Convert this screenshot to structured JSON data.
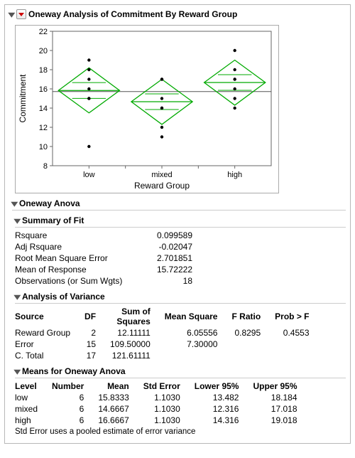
{
  "header": {
    "title": "Oneway Analysis of Commitment By Reward Group"
  },
  "chart_data": {
    "type": "scatter",
    "ylabel": "Commitment",
    "xlabel": "Reward Group",
    "ylim": [
      8,
      22
    ],
    "yticks": [
      8,
      10,
      12,
      14,
      16,
      18,
      20,
      22
    ],
    "categories": [
      "low",
      "mixed",
      "high"
    ],
    "grand_mean": 15.72,
    "series": [
      {
        "name": "low",
        "points": [
          10,
          15,
          15,
          16,
          17,
          18,
          19
        ],
        "mean": 15.8333,
        "diamond_low": 13.5,
        "diamond_high": 18.2
      },
      {
        "name": "mixed",
        "points": [
          11,
          12,
          14,
          14,
          15,
          17,
          17
        ],
        "mean": 14.6667,
        "diamond_low": 12.3,
        "diamond_high": 17.0
      },
      {
        "name": "high",
        "points": [
          14,
          15,
          16,
          17,
          17,
          18,
          20
        ],
        "mean": 16.6667,
        "diamond_low": 14.3,
        "diamond_high": 19.0
      }
    ]
  },
  "sections": {
    "anova_title": "Oneway Anova",
    "fit_title": "Summary of Fit",
    "aov_title": "Analysis of Variance",
    "means_title": "Means for Oneway Anova"
  },
  "summary_of_fit": {
    "rows": [
      {
        "label": "Rsquare",
        "value": "0.099589"
      },
      {
        "label": "Adj Rsquare",
        "value": "-0.02047"
      },
      {
        "label": "Root Mean Square Error",
        "value": "2.701851"
      },
      {
        "label": "Mean of Response",
        "value": "15.72222"
      },
      {
        "label": "Observations (or Sum Wgts)",
        "value": "18"
      }
    ]
  },
  "aov": {
    "headers": {
      "source": "Source",
      "df": "DF",
      "ss_top": "Sum of",
      "ss_bot": "Squares",
      "ms": "Mean Square",
      "f": "F Ratio",
      "p": "Prob > F"
    },
    "rows": [
      {
        "source": "Reward Group",
        "df": "2",
        "ss": "12.11111",
        "ms": "6.05556",
        "f": "0.8295",
        "p": "0.4553"
      },
      {
        "source": "Error",
        "df": "15",
        "ss": "109.50000",
        "ms": "7.30000",
        "f": "",
        "p": ""
      },
      {
        "source": "C. Total",
        "df": "17",
        "ss": "121.61111",
        "ms": "",
        "f": "",
        "p": ""
      }
    ]
  },
  "means": {
    "headers": {
      "level": "Level",
      "n": "Number",
      "mean": "Mean",
      "se": "Std Error",
      "lo": "Lower 95%",
      "hi": "Upper 95%"
    },
    "rows": [
      {
        "level": "low",
        "n": "6",
        "mean": "15.8333",
        "se": "1.1030",
        "lo": "13.482",
        "hi": "18.184"
      },
      {
        "level": "mixed",
        "n": "6",
        "mean": "14.6667",
        "se": "1.1030",
        "lo": "12.316",
        "hi": "17.018"
      },
      {
        "level": "high",
        "n": "6",
        "mean": "16.6667",
        "se": "1.1030",
        "lo": "14.316",
        "hi": "19.018"
      }
    ],
    "note": "Std Error uses a pooled estimate of error variance"
  }
}
